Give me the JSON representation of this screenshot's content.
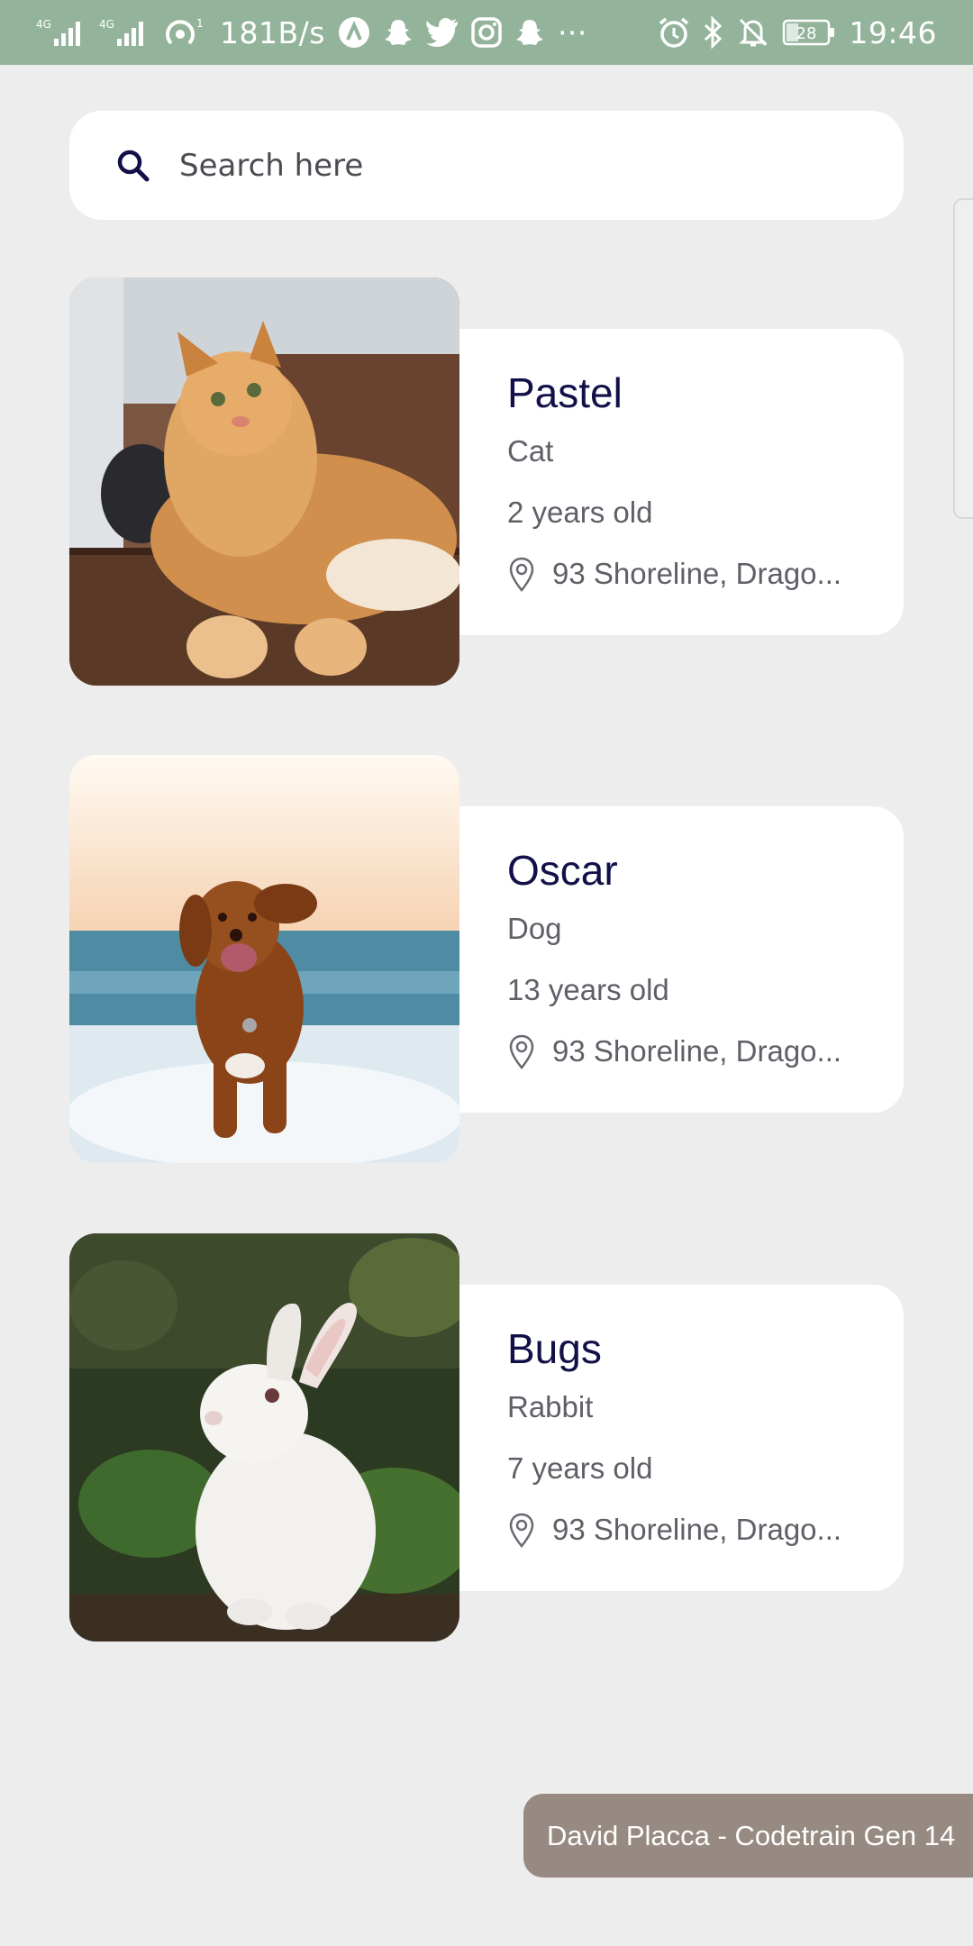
{
  "status_bar": {
    "network_1": "4G",
    "network_2": "4G",
    "hotspot_count": "1",
    "speed": "181B/s",
    "more": "···",
    "battery": "28",
    "time": "19:46",
    "icons": [
      "signal-icon",
      "signal-icon",
      "hotspot-icon",
      "app-icon",
      "snapchat-icon",
      "twitter-icon",
      "instagram-icon",
      "snapchat-icon",
      "alarm-icon",
      "bluetooth-icon",
      "mute-icon",
      "battery-icon"
    ]
  },
  "search": {
    "placeholder": "Search here"
  },
  "pets": [
    {
      "name": "Pastel",
      "species": "Cat",
      "age": "2 years old",
      "location": "93 Shoreline, Drago..."
    },
    {
      "name": "Oscar",
      "species": "Dog",
      "age": "13 years old",
      "location": "93 Shoreline, Drago..."
    },
    {
      "name": "Bugs",
      "species": "Rabbit",
      "age": "7 years old",
      "location": "93 Shoreline, Drago..."
    }
  ],
  "footer": {
    "credit": "David Placca - Codetrain Gen 14"
  },
  "colors": {
    "status_bar": "#93b49b",
    "background": "#eeeded",
    "name": "#121048",
    "badge": "#978a82"
  }
}
